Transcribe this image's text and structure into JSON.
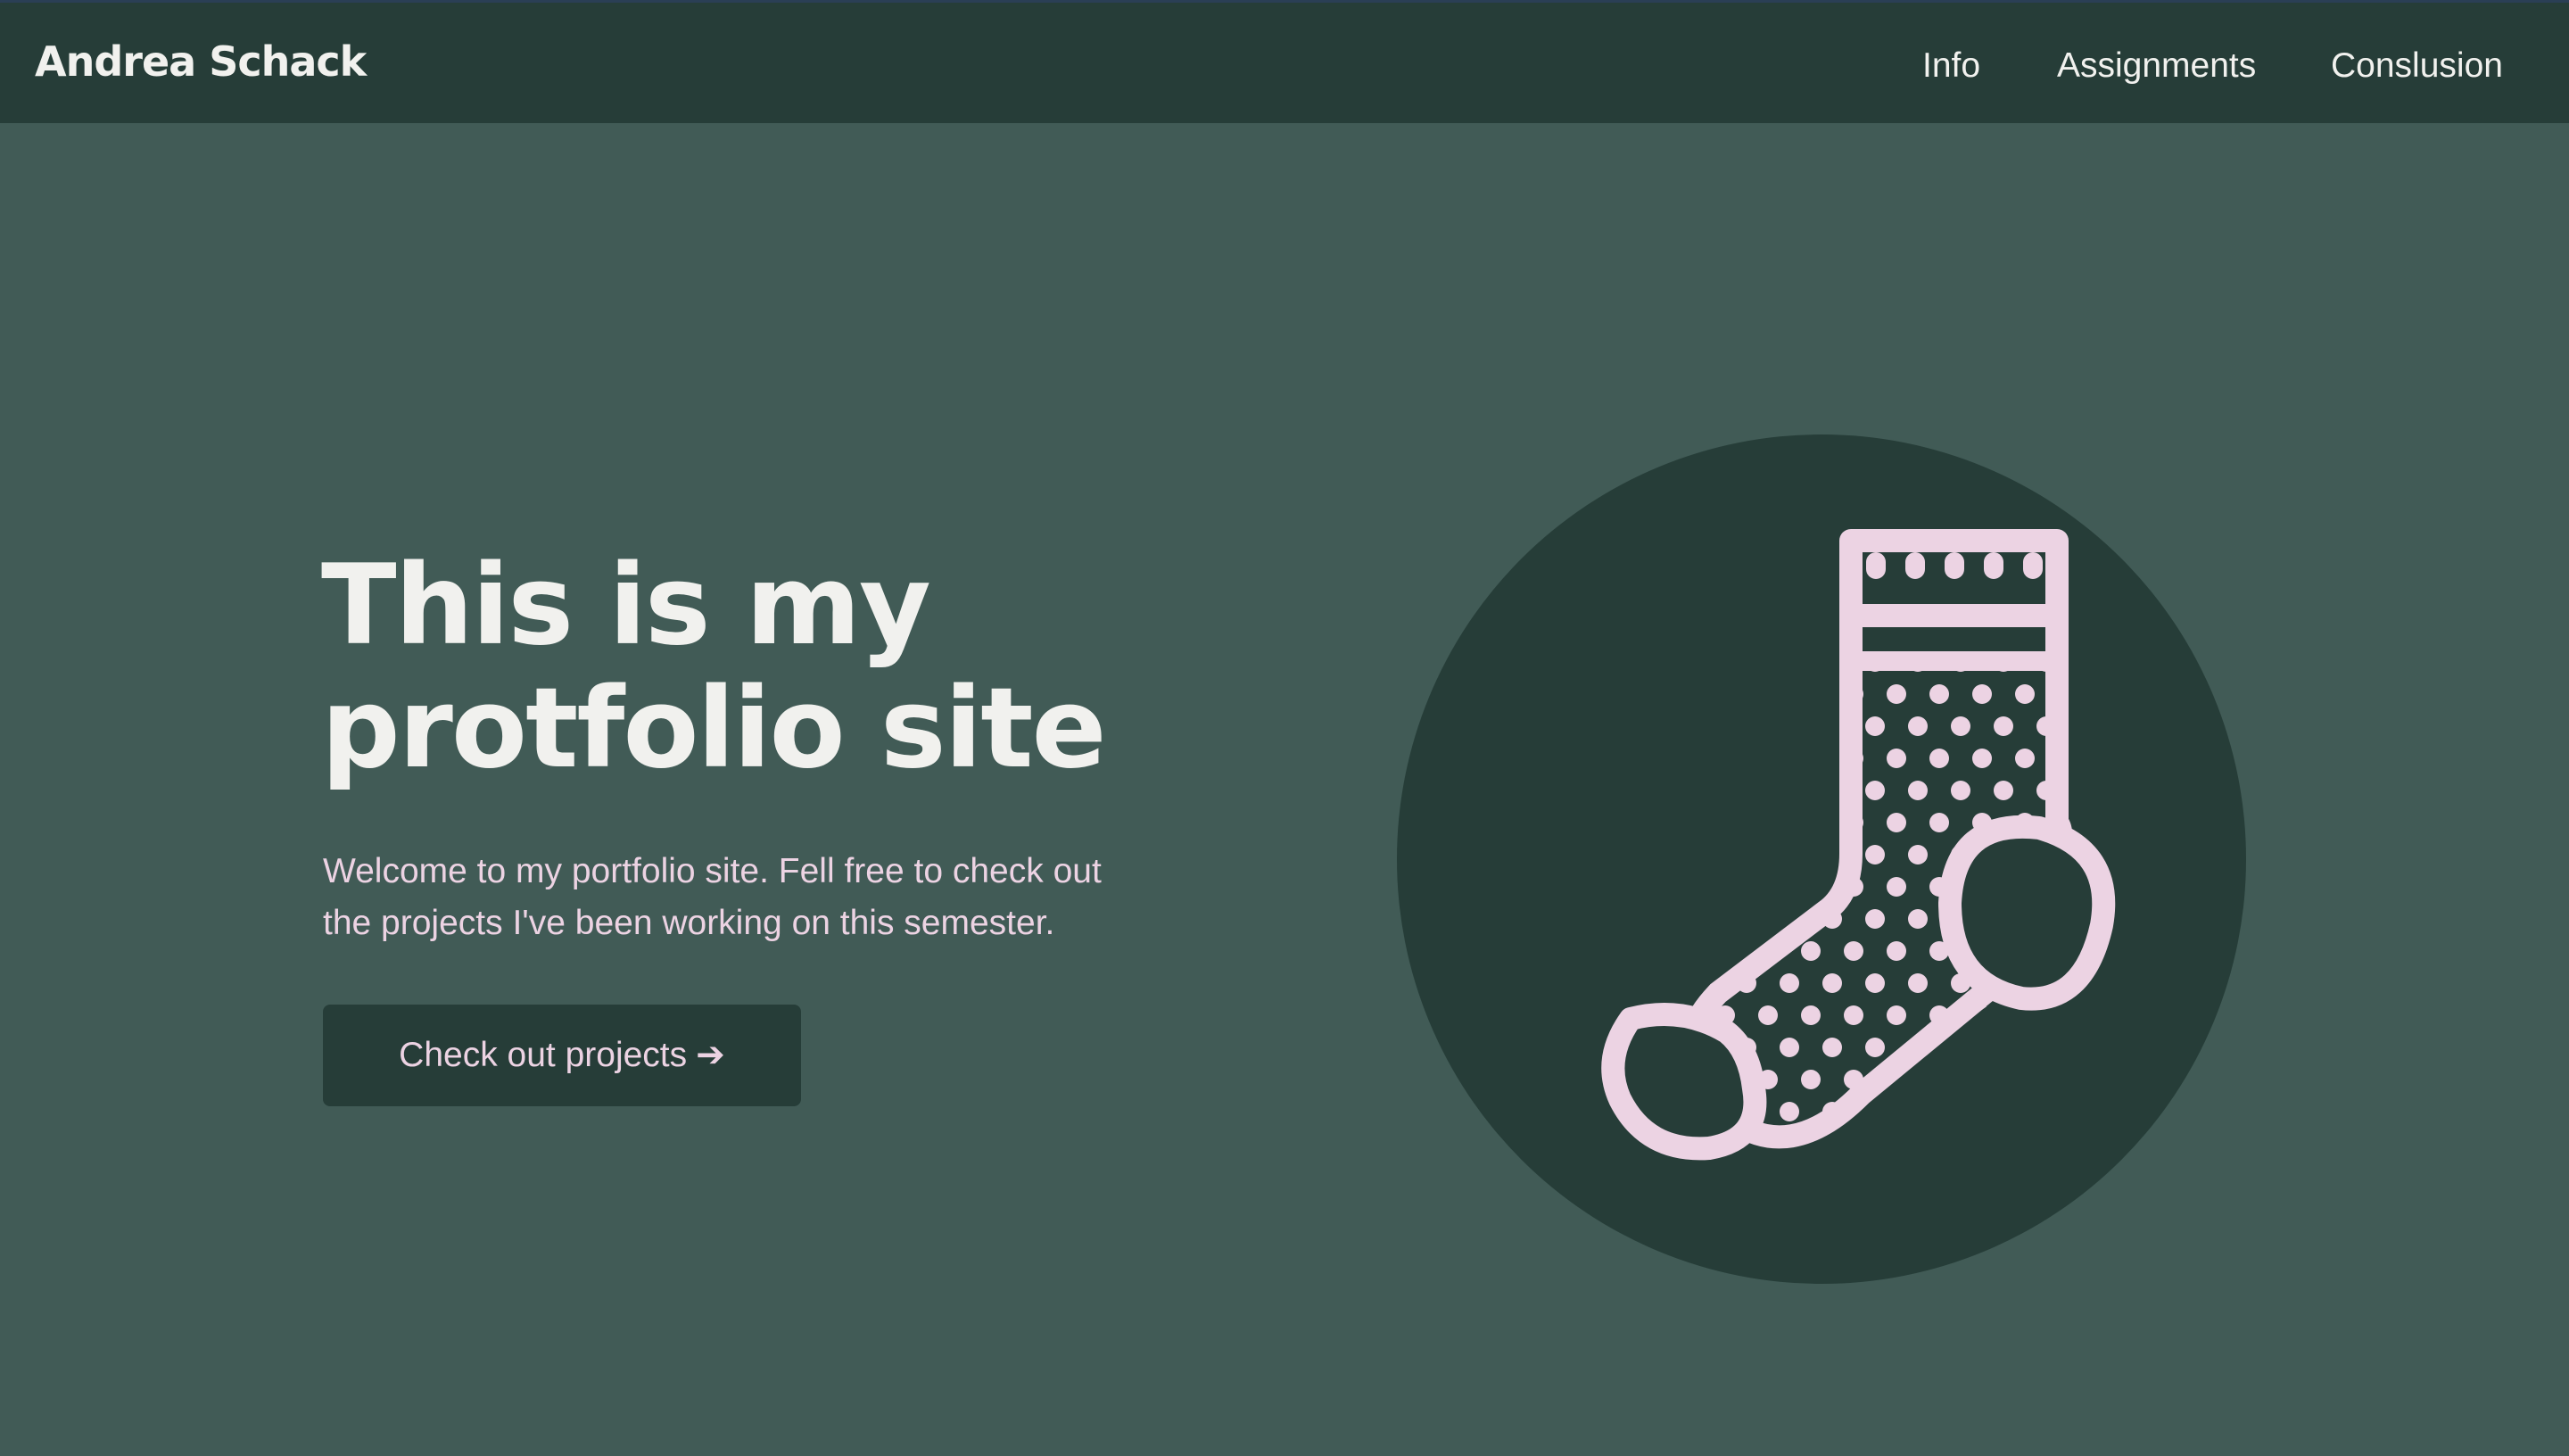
{
  "header": {
    "brand": "Andrea Schack",
    "nav": [
      {
        "label": "Info"
      },
      {
        "label": "Assignments"
      },
      {
        "label": "Conslusion"
      }
    ]
  },
  "hero": {
    "title": "This is my protfolio site",
    "intro": "Welcome to my portfolio site. Fell free to check out the projects I've been working on this semester.",
    "cta_label": "Check out projects",
    "cta_icon": "arrow-right-icon",
    "illustration_icon": "sock-icon"
  },
  "colors": {
    "page_background": "#415b56",
    "header_background": "#263d38",
    "accent_pink": "#ecd3e3",
    "text_light": "#f1f1ee"
  }
}
